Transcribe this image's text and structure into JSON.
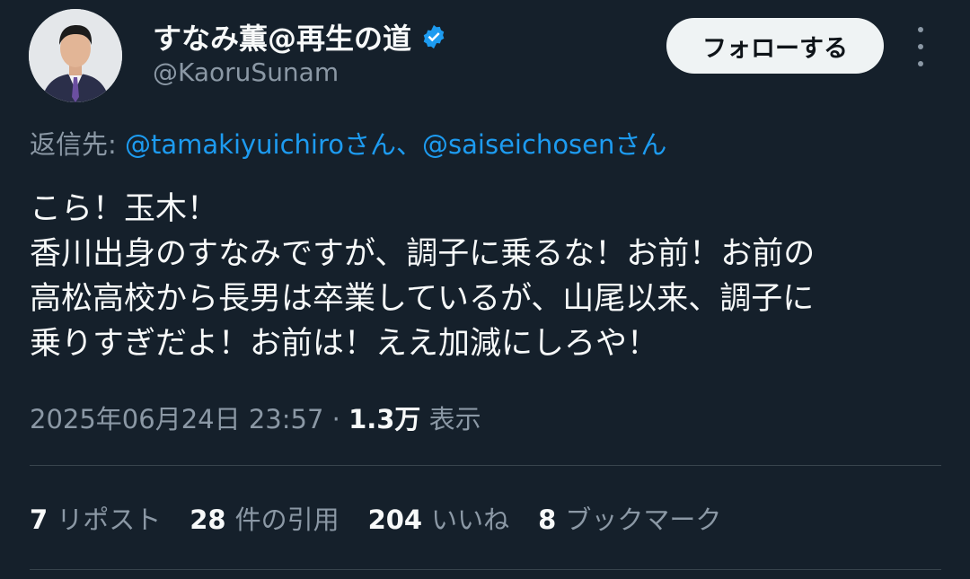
{
  "user": {
    "display_name": "すなみ薫@再生の道",
    "handle": "@KaoruSunam",
    "verified": true
  },
  "follow_label": "フォローする",
  "reply": {
    "prefix": "返信先: ",
    "mention1": "@tamakiyuichiro",
    "suffix1": "さん、",
    "mention2": "@saiseichosen",
    "suffix2": "さん"
  },
  "tweet_lines": [
    "こら！玉木！",
    "香川出身のすなみですが、調子に乗るな！お前！お前の",
    "高松高校から長男は卒業しているが、山尾以来、調子に",
    "乗りすぎだよ！お前は！ええ加減にしろや！"
  ],
  "meta": {
    "timestamp": "2025年06月24日 23:57",
    "separator": " · ",
    "views_count": "1.3万",
    "views_label": " 表示"
  },
  "stats": {
    "reposts_count": "7",
    "reposts_label": "リポスト",
    "quotes_count": "28",
    "quotes_label": "件の引用",
    "likes_count": "204",
    "likes_label": "いいね",
    "bookmarks_count": "8",
    "bookmarks_label": "ブックマーク"
  },
  "colors": {
    "background": "#15202b",
    "link": "#1d9bf0",
    "secondary_text": "#8b98a5"
  }
}
